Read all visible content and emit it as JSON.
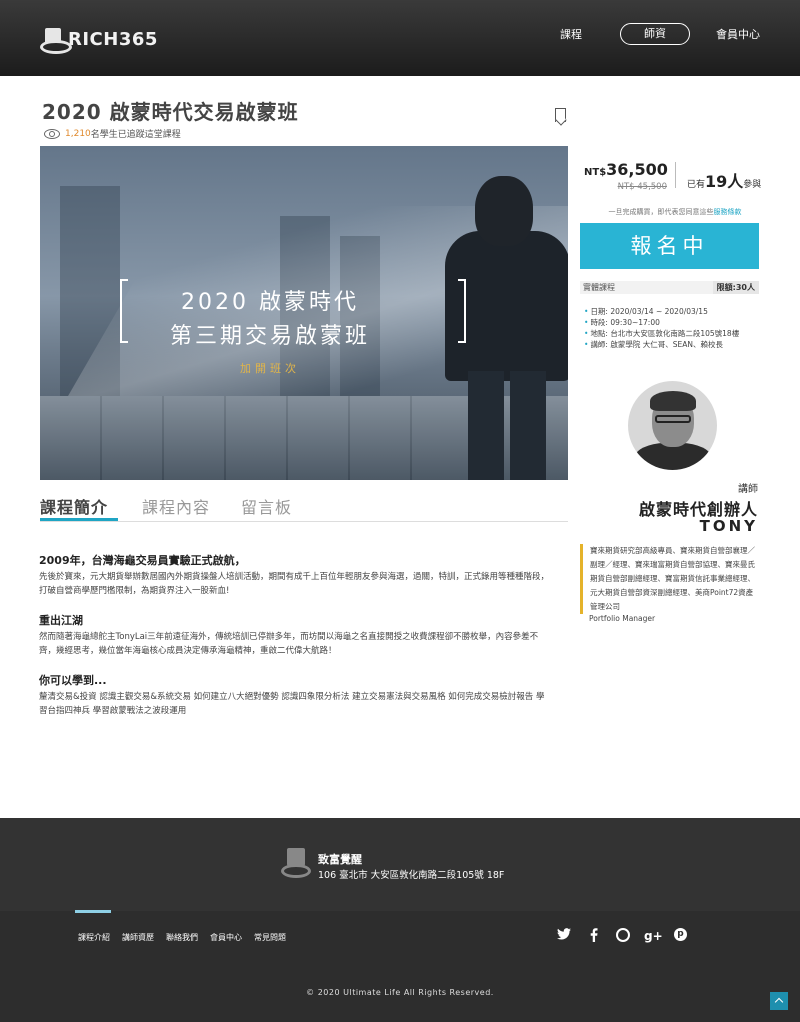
{
  "header": {
    "logo_text": "RICH365",
    "nav": [
      "課程",
      "師資",
      "會員中心"
    ]
  },
  "course": {
    "title": "2020 啟蒙時代交易啟蒙班",
    "views_count": "1,210",
    "views_suffix": "名學生已追蹤這堂課程"
  },
  "banner": {
    "line1": "2020 啟蒙時代",
    "line2": "第三期交易啟蒙班",
    "sub": "加開班次"
  },
  "tabs": [
    "課程簡介",
    "課程內容",
    "留言板"
  ],
  "content": {
    "sections": [
      {
        "heading": "2009年，台灣海龜交易員實驗正式啟航，",
        "body": "先後於寶來，元大期貨舉辦數屆國內外期貨操盤人培訓活動，期間有成千上百位年輕朋友參與海選，過關，特訓，正式錄用等種種階段，打破自營商學歷門檻限制，為期貨界注入一股新血!"
      },
      {
        "heading": "重出江湖",
        "body": "然而隨著海龜總舵主TonyLai三年前遠征海外，傳統培訓已停辦多年，而坊間以海龜之名直接開授之收費課程卻不勝枚舉，內容參差不齊，幾經思考，幾位當年海龜核心成員決定傳承海龜精神，重啟二代偉大航路！"
      },
      {
        "heading": "你可以學到...",
        "body": "釐清交易&投資 認識主觀交易&系統交易 如何建立八大絕對優勢 認識四象限分析法 建立交易憲法與交易風格 如何完成交易檢討報告 學習台指四神兵 學習啟蒙戰法之波段運用"
      }
    ]
  },
  "pricing": {
    "currency": "NT$",
    "price_now": "36,500",
    "price_old": "NT$ 45,500",
    "joined_prefix": "已有",
    "joined_count": "19人",
    "joined_suffix": "參與",
    "note_prefix": "一旦完成購買，即代表您同意這些",
    "note_link": "服務條款",
    "signup_label": "報名中",
    "course_type": "實體課程",
    "quota": "限額:30人",
    "info": [
      "日期: 2020/03/14 ~ 2020/03/15",
      "時段: 09:30~17:00",
      "地點: 台北市大安區敦化南路二段105號18樓",
      "講師: 啟蒙學院 大仁哥、SEAN、賴校長"
    ]
  },
  "instructor": {
    "role": "講師",
    "title": "啟蒙時代創辦人",
    "name": "TONY",
    "bio": "寶來期貨研究部高級專員、寶來期貨自營部襄理／副理／經理、寶來瑞富期貨自營部協理、寶來曼氏期貨自營部副總經理、寶富期貨信託事業總經理、元大期貨自營部資深副總經理、美商Point72資產管理公司",
    "bio_extra": "Portfolio Manager"
  },
  "footer": {
    "company": "致富覺醒",
    "address": "106 臺北市 大安區敦化南路二段105號 18F",
    "links": [
      "課程介紹",
      "講師資歷",
      "聯絡我們",
      "會員中心",
      "常見問題"
    ],
    "social": [
      "twitter-icon",
      "facebook-icon",
      "dribbble-icon",
      "google-plus-icon",
      "pinterest-icon"
    ],
    "copyright": "© 2020 Ultimate Life All Rights Reserved."
  },
  "colors": {
    "accent": "#29b4d4",
    "highlight": "#e08a2e",
    "bio_border": "#e5b32a"
  }
}
